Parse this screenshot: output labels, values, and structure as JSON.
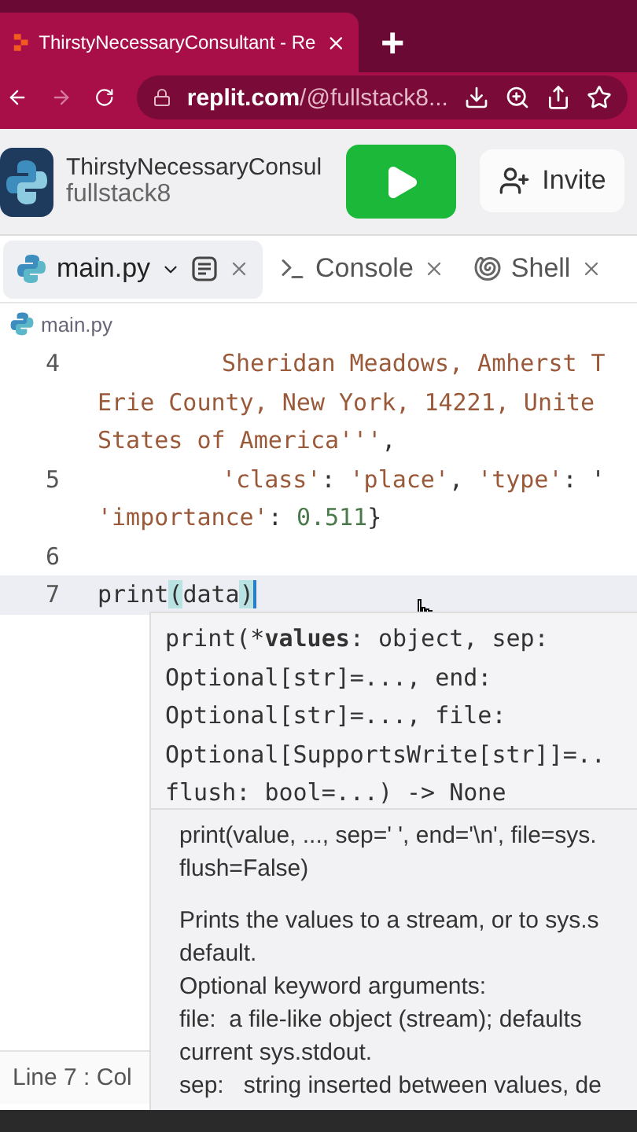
{
  "browser": {
    "tab_title": "ThirstyNecessaryConsultant - Re",
    "new_tab": "+",
    "url_host": "replit.com",
    "url_path": "/@fullstack8..."
  },
  "header": {
    "repl_name": "ThirstyNecessaryConsul",
    "owner": "fullstack8",
    "invite": "Invite"
  },
  "file_tabs": [
    {
      "label": "main.py",
      "kind": "file",
      "selected": true
    },
    {
      "label": "Console",
      "kind": "console",
      "selected": false
    },
    {
      "label": "Shell",
      "kind": "shell",
      "selected": false
    }
  ],
  "breadcrumb": "main.py",
  "code_lines": [
    {
      "number": "4",
      "current": false,
      "indented": true,
      "tokens": [
        {
          "text": "Sheridan Meadows, Amherst T",
          "kind": "string"
        }
      ]
    },
    {
      "current": false,
      "tokens": [
        {
          "text": "Erie County, New York, 14221, Unite",
          "kind": "string"
        }
      ]
    },
    {
      "current": false,
      "tokens": [
        {
          "text": "States of America'''",
          "kind": "string"
        },
        {
          "text": ",",
          "kind": "plain"
        }
      ]
    },
    {
      "number": "5",
      "current": false,
      "indented": true,
      "tokens": [
        {
          "text": "'class'",
          "kind": "string"
        },
        {
          "text": ": ",
          "kind": "plain"
        },
        {
          "text": "'place'",
          "kind": "string"
        },
        {
          "text": ", ",
          "kind": "plain"
        },
        {
          "text": "'type'",
          "kind": "string"
        },
        {
          "text": ": '",
          "kind": "plain"
        }
      ]
    },
    {
      "current": false,
      "tokens": [
        {
          "text": "'importance'",
          "kind": "string"
        },
        {
          "text": ": ",
          "kind": "plain"
        },
        {
          "text": "0.511",
          "kind": "number"
        },
        {
          "text": "}",
          "kind": "plain"
        }
      ]
    },
    {
      "number": "6",
      "current": false
    },
    {
      "number": "7",
      "current": true,
      "tokens": [
        {
          "text": "print",
          "kind": "plain"
        },
        {
          "text": "(",
          "kind": "bracket"
        },
        {
          "text": "data",
          "kind": "plain"
        },
        {
          "text": ")",
          "kind": "bracket"
        }
      ]
    }
  ],
  "signature": [
    [
      {
        "text": "print(*",
        "bold": false
      },
      {
        "text": "values",
        "bold": true
      },
      {
        "text": ": object, sep:",
        "bold": false
      }
    ],
    [
      {
        "text": "Optional[str]=..., end:",
        "bold": false
      }
    ],
    [
      {
        "text": "Optional[str]=..., file:",
        "bold": false
      }
    ],
    [
      {
        "text": "Optional[SupportsWrite[str]]=..",
        "bold": false
      }
    ],
    [
      {
        "text": "flush: bool=...) -> None",
        "bold": false
      }
    ]
  ],
  "doc": {
    "signature_lines": [
      "print(value, ..., sep=' ', end='\\n', file=sys.",
      "flush=False)"
    ],
    "paragraph_lines": [
      "Prints the values to a stream, or to sys.s",
      "default.",
      "Optional keyword arguments:",
      "file:  a file-like object (stream); defaults",
      "current sys.stdout.",
      "sep:   string inserted between values, de"
    ]
  },
  "status": "Line 7 : Col"
}
